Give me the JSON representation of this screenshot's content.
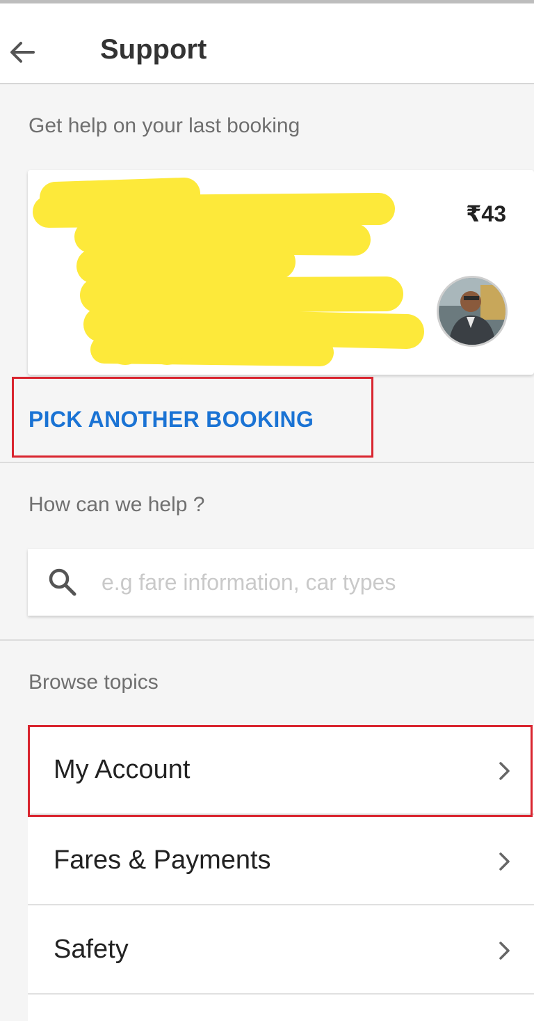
{
  "appbar": {
    "title": "Support",
    "back_icon": "arrow-left-icon"
  },
  "last_booking": {
    "section_label": "Get help on your last booking",
    "fare": "₹43",
    "details_redacted": true
  },
  "pick_another": {
    "label": "PICK ANOTHER BOOKING",
    "color": "#1a73d4"
  },
  "help": {
    "section_label": "How can we help ?",
    "search_placeholder": "e.g fare information, car types",
    "search_icon": "magnifier-icon"
  },
  "browse": {
    "section_label": "Browse topics",
    "topics": [
      {
        "label": "My Account"
      },
      {
        "label": "Fares & Payments"
      },
      {
        "label": "Safety"
      }
    ]
  },
  "colors": {
    "highlight": "#d9252f",
    "redaction": "#fde93a"
  }
}
